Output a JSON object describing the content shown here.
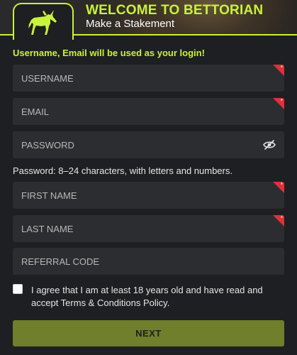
{
  "header": {
    "title": "WELCOME TO BETTORIAN",
    "subtitle": "Make a Stakement",
    "accent_color": "#c9f23a",
    "logo_icon": "unicorn-icon"
  },
  "form": {
    "note": "Username, Email will be used as your login!",
    "fields": {
      "username": {
        "placeholder": "USERNAME",
        "value": "",
        "required": true
      },
      "email": {
        "placeholder": "EMAIL",
        "value": "",
        "required": true
      },
      "password": {
        "placeholder": "PASSWORD",
        "value": "",
        "required": false,
        "icon": "eye-slash-icon"
      },
      "first_name": {
        "placeholder": "FIRST NAME",
        "value": "",
        "required": true
      },
      "last_name": {
        "placeholder": "LAST NAME",
        "value": "",
        "required": true
      },
      "referral_code": {
        "placeholder": "REFERRAL CODE",
        "value": "",
        "required": false
      }
    },
    "password_hint": "Password: 8–24 characters, with letters and numbers.",
    "agreement_text": "I agree that I am at least 18 years old and have read and accept Terms & Conditions Policy.",
    "agreement_checked": false,
    "next_label": "NEXT",
    "required_marker": "*",
    "required_color": "#e0303a",
    "button_color": "#6f7f2c"
  }
}
